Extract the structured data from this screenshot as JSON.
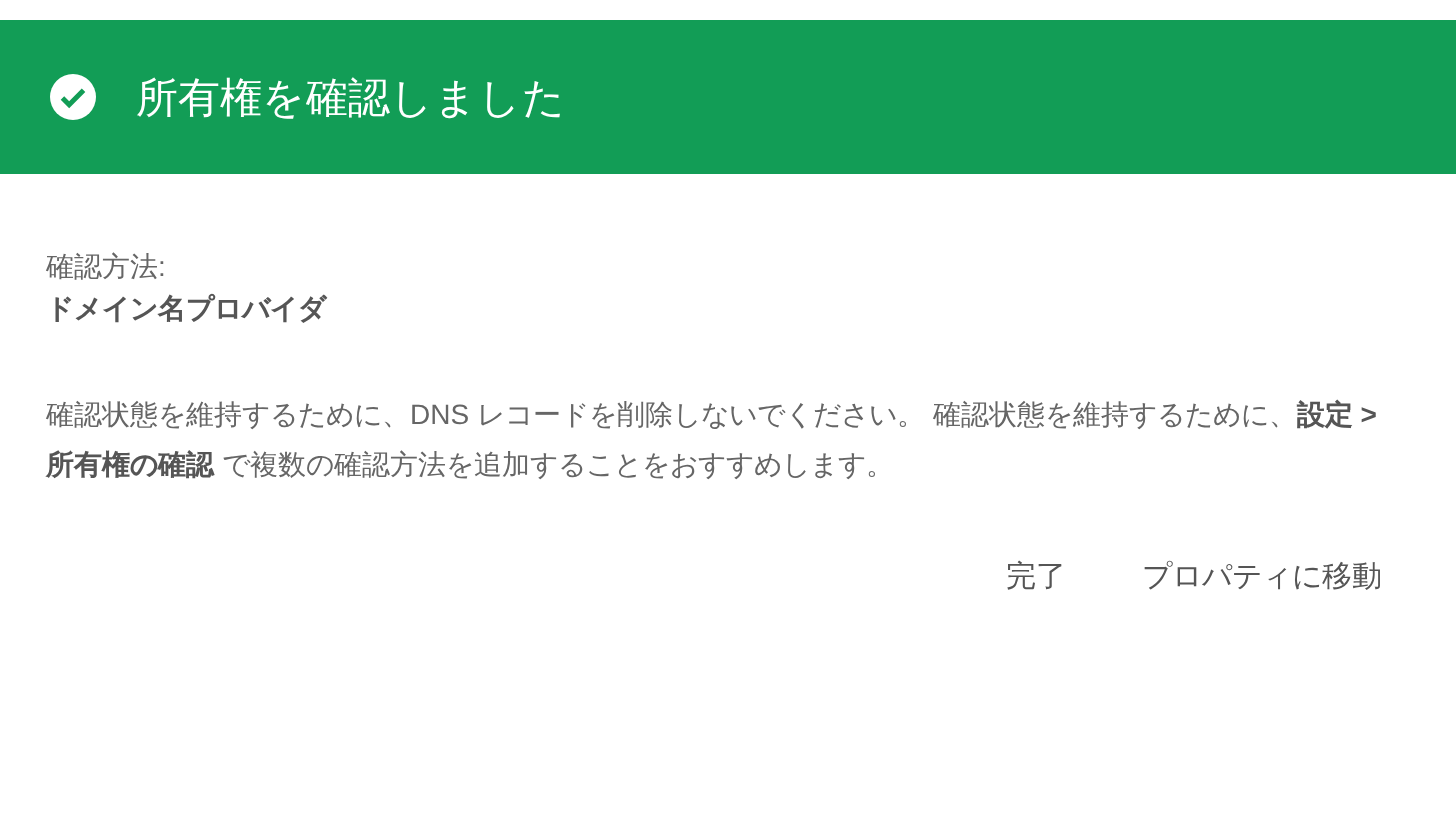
{
  "header": {
    "title": "所有権を確認しました"
  },
  "method": {
    "label": "確認方法:",
    "value": "ドメイン名プロバイダ"
  },
  "message": "確認状態を維持するために、DNS レコードを削除しないでください。 確認状態を維持するために、**設定 > 所有権の確認** で複数の確認方法を追加することをおすすめします。",
  "buttons": [
    "完了",
    "プロパティに移動"
  ]
}
